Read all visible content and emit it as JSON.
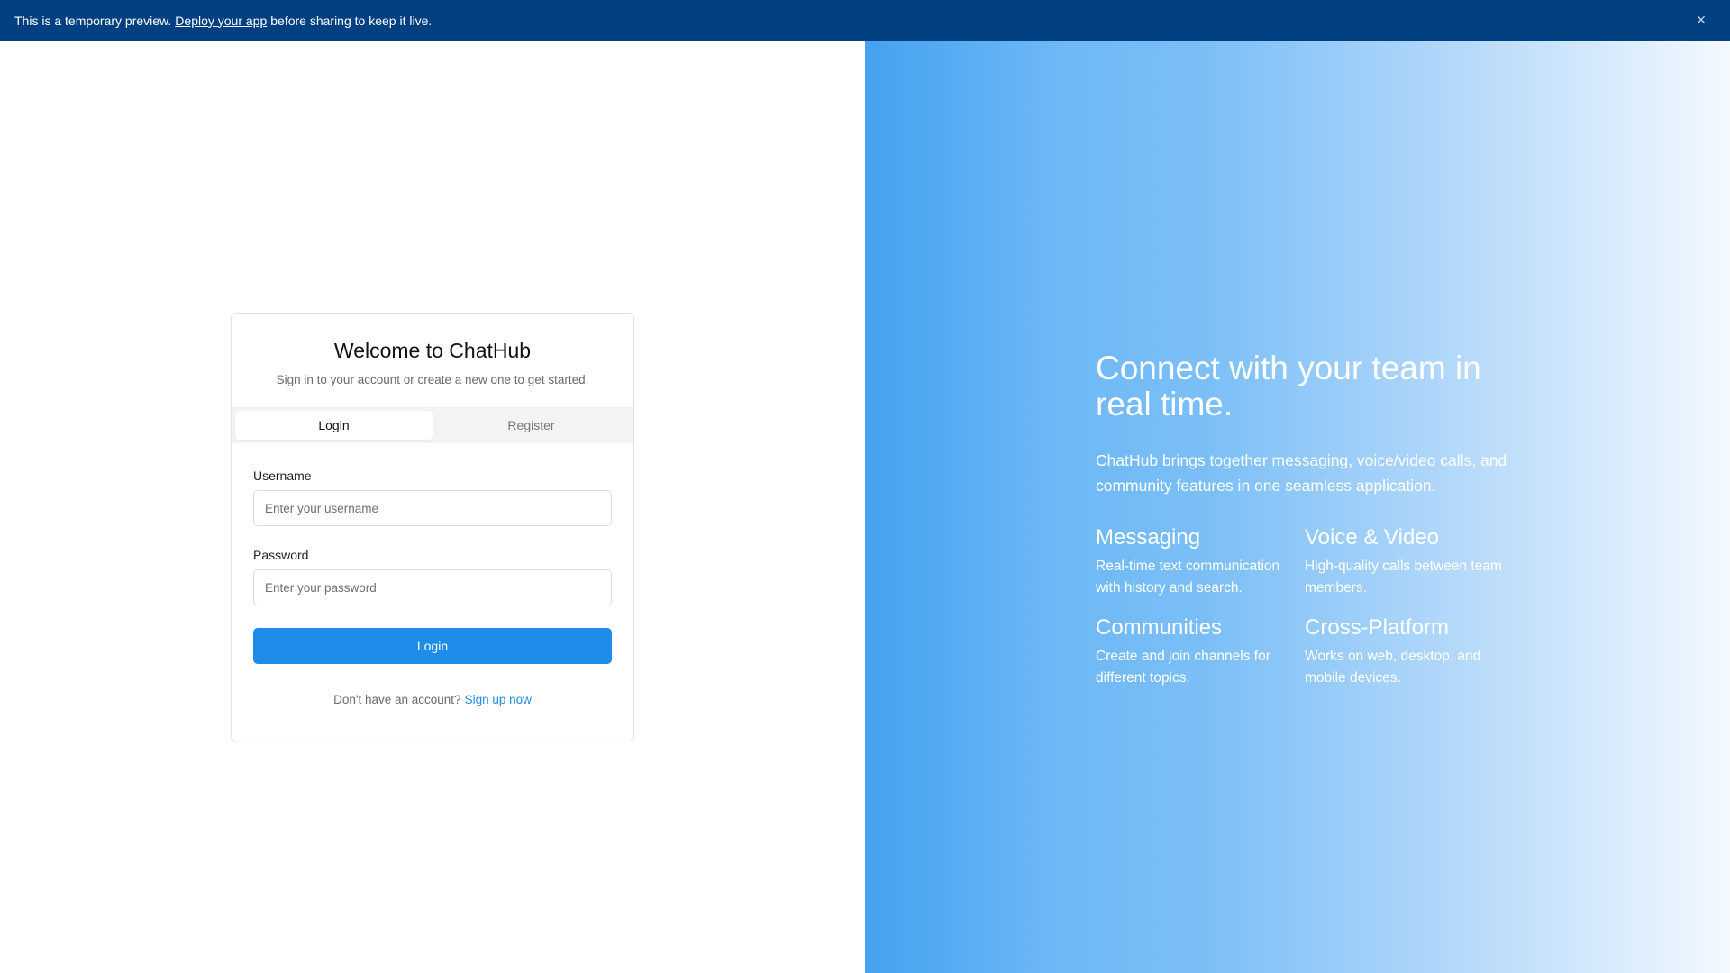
{
  "banner": {
    "text_before": "This is a temporary preview.",
    "link_label": "Deploy your app",
    "text_after": "before sharing to keep it live.",
    "close_glyph": "×"
  },
  "auth_card": {
    "title": "Welcome to ChatHub",
    "subtitle": "Sign in to your account or create a new one to get started.",
    "tabs": [
      {
        "label": "Login",
        "active": true
      },
      {
        "label": "Register",
        "active": false
      }
    ],
    "username": {
      "label": "Username",
      "placeholder": "Enter your username",
      "value": ""
    },
    "password": {
      "label": "Password",
      "placeholder": "Enter your password",
      "value": ""
    },
    "submit_label": "Login",
    "signup_prompt": "Don't have an account?",
    "signup_link": "Sign up now"
  },
  "hero": {
    "title": "Connect with your team in real time.",
    "description": "ChatHub brings together messaging, voice/video calls, and community features in one seamless application.",
    "features": [
      {
        "title": "Messaging",
        "description": "Real-time text communication with history and search."
      },
      {
        "title": "Voice & Video",
        "description": "High-quality calls between team members."
      },
      {
        "title": "Communities",
        "description": "Create and join channels for different topics."
      },
      {
        "title": "Cross-Platform",
        "description": "Works on web, desktop, and mobile devices."
      }
    ]
  },
  "colors": {
    "banner_bg": "#004080",
    "primary": "#1e8ce8",
    "gradient_start": "#44a2f0",
    "gradient_end": "#f4f9fe"
  }
}
